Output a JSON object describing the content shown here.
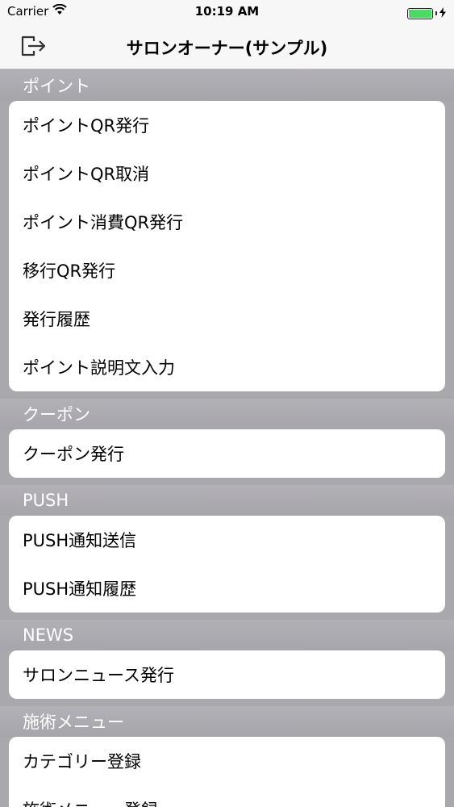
{
  "status_bar": {
    "carrier": "Carrier",
    "time": "10:19 AM",
    "battery_color": "#4cd964"
  },
  "nav": {
    "title": "サロンオーナー(サンプル)",
    "logout_icon": "logout-icon"
  },
  "sections": [
    {
      "header": "ポイント",
      "items": [
        "ポイントQR発行",
        "ポイントQR取消",
        "ポイント消費QR発行",
        "移行QR発行",
        "発行履歴",
        "ポイント説明文入力"
      ]
    },
    {
      "header": "クーポン",
      "items": [
        "クーポン発行"
      ]
    },
    {
      "header": "PUSH",
      "items": [
        "PUSH通知送信",
        "PUSH通知履歴"
      ]
    },
    {
      "header": "NEWS",
      "items": [
        "サロンニュース発行"
      ]
    },
    {
      "header": "施術メニュー",
      "items": [
        "カテゴリー登録",
        "施術メニュー登録"
      ]
    }
  ]
}
